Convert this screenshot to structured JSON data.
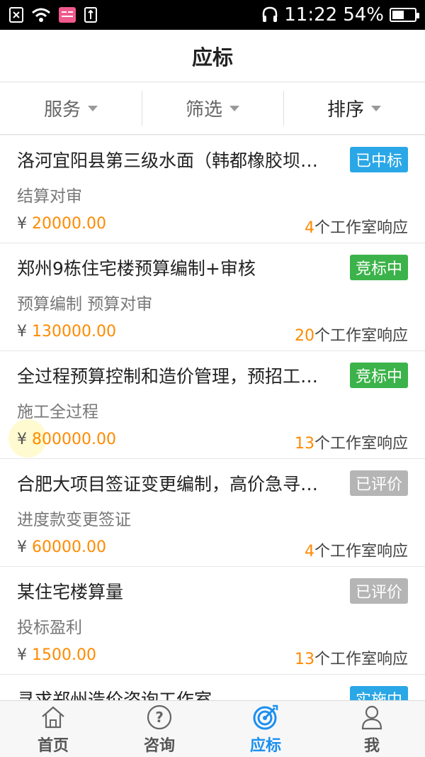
{
  "status_bar": {
    "time": "11:22",
    "battery": "54%",
    "battery_level": 0.54,
    "icons": [
      "close-box-icon",
      "wifi-icon",
      "notification-app-icon",
      "usb-icon",
      "headphones-icon",
      "battery-icon"
    ]
  },
  "header": {
    "title": "应标"
  },
  "filters": [
    {
      "label": "服务"
    },
    {
      "label": "筛选"
    },
    {
      "label": "排序"
    }
  ],
  "cards": [
    {
      "title": "洛河宜阳县第三级水面（韩都橡胶坝…",
      "status": "已中标",
      "status_color": "#2aa7e6",
      "subtitle": "结算对审",
      "currency": "¥",
      "amount": "20000.00",
      "count": "4",
      "count_suffix": "个工作室响应"
    },
    {
      "title": "郑州9栋住宅楼预算编制+审核",
      "status": "竞标中",
      "status_color": "#3cb34a",
      "subtitle": "预算编制 预算对审",
      "currency": "¥",
      "amount": "130000.00",
      "count": "20",
      "count_suffix": "个工作室响应"
    },
    {
      "title": "全过程预算控制和造价管理，预招工…",
      "status": "竞标中",
      "status_color": "#3cb34a",
      "subtitle": "施工全过程",
      "currency": "¥",
      "amount": "800000.00",
      "count": "13",
      "count_suffix": "个工作室响应"
    },
    {
      "title": "合肥大项目签证变更编制，高价急寻…",
      "status": "已评价",
      "status_color": "#b5b5b5",
      "subtitle": "进度款变更签证",
      "currency": "¥",
      "amount": "60000.00",
      "count": "4",
      "count_suffix": "个工作室响应"
    },
    {
      "title": "某住宅楼算量",
      "status": "已评价",
      "status_color": "#b5b5b5",
      "subtitle": "投标盈利",
      "currency": "¥",
      "amount": "1500.00",
      "count": "13",
      "count_suffix": "个工作室响应"
    },
    {
      "title": "寻求郑州造价咨询工作室",
      "status": "实施中",
      "status_color": "#2aa7e6",
      "subtitle": "",
      "currency": "",
      "amount": "",
      "count": "",
      "count_suffix": ""
    }
  ],
  "tabs": [
    {
      "label": "首页",
      "icon": "home-icon"
    },
    {
      "label": "咨询",
      "icon": "question-icon"
    },
    {
      "label": "应标",
      "icon": "target-icon"
    },
    {
      "label": "我",
      "icon": "person-icon"
    }
  ],
  "colors": {
    "accent": "#1a8ff0",
    "price": "#ff8a00"
  }
}
